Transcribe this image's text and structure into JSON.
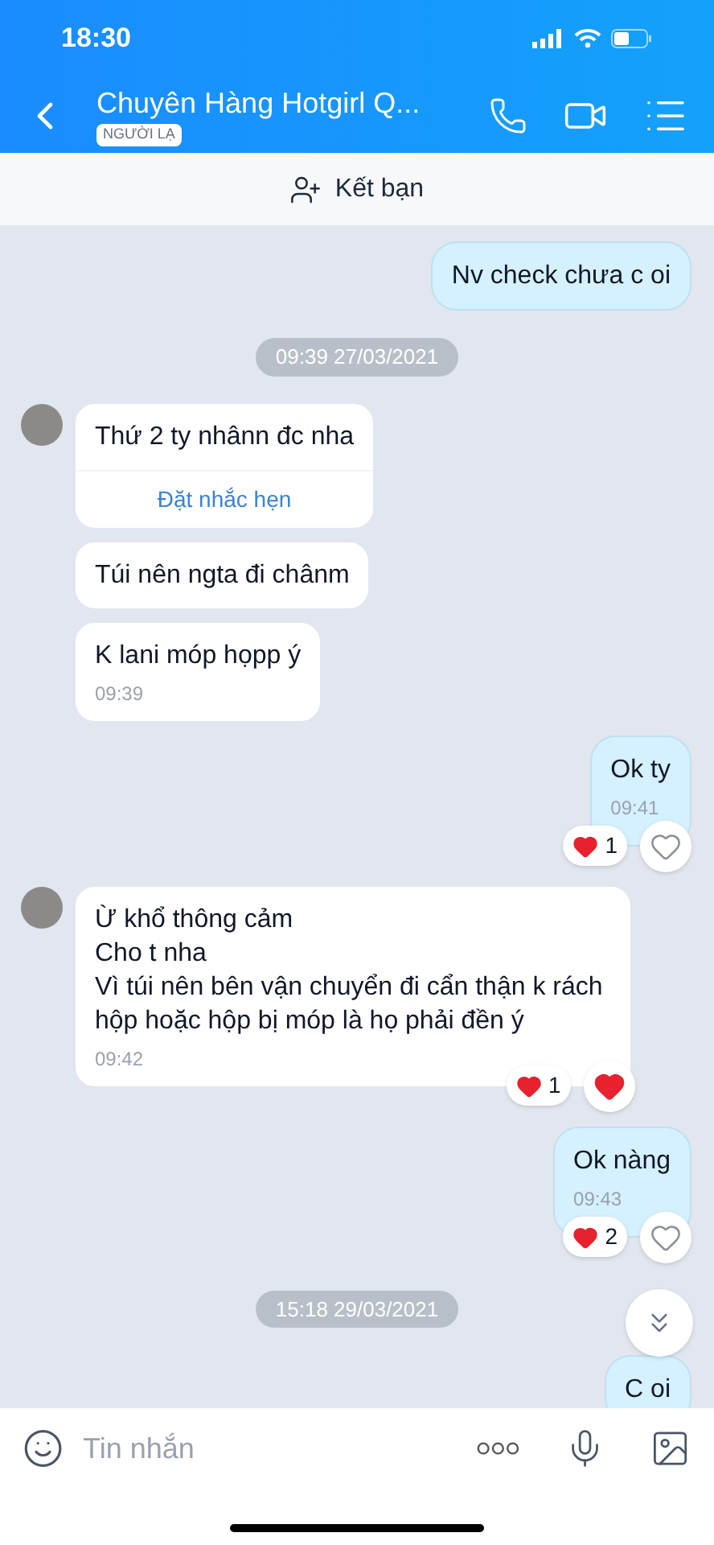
{
  "status_bar": {
    "time": "18:30"
  },
  "header": {
    "title": "Chuyên Hàng Hotgirl Q...",
    "badge": "NGƯỜI LẠ"
  },
  "add_friend": {
    "label": "Kết bạn"
  },
  "messages": [
    {
      "kind": "sent",
      "text": "Nv check chưa c oi"
    },
    {
      "kind": "date",
      "text": "09:39 27/03/2021"
    },
    {
      "kind": "received",
      "avatar": true,
      "text": "Thứ 2 ty nhânn đc nha",
      "action": "Đặt nhắc hẹn"
    },
    {
      "kind": "received",
      "avatar": false,
      "text": "Túi nên ngta đi chânm"
    },
    {
      "kind": "received",
      "avatar": false,
      "text": "K lani móp họpp ý",
      "time": "09:39"
    },
    {
      "kind": "sent",
      "text": "Ok ty",
      "time": "09:41",
      "reaction_count": "1",
      "liked": false
    },
    {
      "kind": "received",
      "avatar": true,
      "text": "Ừ khổ thông cảm\nCho t nha\nVì túi nên bên vận chuyển đi cẩn thận k rách hộp hoặc hộp bị móp là họ phải đền ý",
      "time": "09:42",
      "reaction_count": "1",
      "liked": true
    },
    {
      "kind": "sent",
      "text": "Ok nàng",
      "time": "09:43",
      "reaction_count": "2",
      "liked": false
    },
    {
      "kind": "date",
      "text": "15:18 29/03/2021"
    },
    {
      "kind": "sent",
      "text": "C oi"
    }
  ],
  "composer": {
    "placeholder": "Tin nhắn"
  }
}
